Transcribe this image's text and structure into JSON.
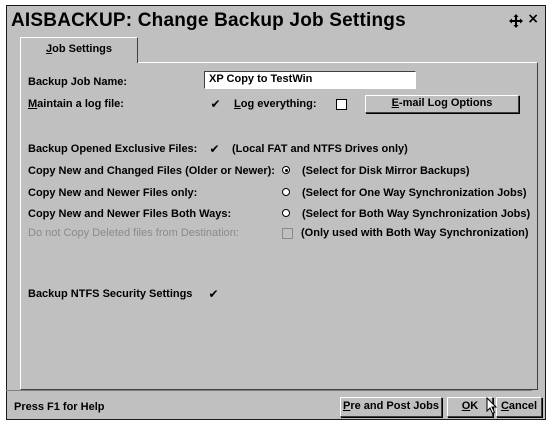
{
  "window": {
    "title": "AISBACKUP: Change Backup Job Settings"
  },
  "tabs": [
    {
      "label": "Job Settings",
      "underline": "J",
      "rest": "ob Settings"
    }
  ],
  "form": {
    "job_name_label": "Backup Job Name:",
    "job_name_value": "XP Copy to TestWin",
    "log_label_u": "M",
    "log_label_rest": "aintain a log file:",
    "log_checked": true,
    "log_everything_u": "L",
    "log_everything_rest": "og everything:",
    "log_everything_checked": false,
    "email_button_u": "E",
    "email_button_rest": "-mail Log Options",
    "opened_label": "Backup Opened Exclusive Files:",
    "opened_checked": true,
    "opened_note": "(Local FAT and NTFS Drives only)",
    "options": [
      {
        "label": "Copy New and Changed Files (Older or Newer):",
        "note": "(Select for Disk Mirror Backups)",
        "selected": true
      },
      {
        "label": "Copy New and Newer Files only:",
        "note": "(Select for One Way Synchronization Jobs)",
        "selected": false
      },
      {
        "label": "Copy New and Newer Files Both Ways:",
        "note": "(Select for Both Way Synchronization Jobs)",
        "selected": false
      }
    ],
    "deleted_label": "Do not Copy Deleted files from Destination:",
    "deleted_note": "(Only used with Both Way Synchronization)",
    "deleted_checked": false,
    "ntfs_label": "Backup NTFS Security Settings",
    "ntfs_checked": true
  },
  "status": {
    "help": "Press F1 for Help",
    "pre_post_u": "P",
    "pre_post_rest": "re and Post Jobs",
    "ok_u": "O",
    "ok_rest": "K",
    "cancel_u": "C",
    "cancel_rest": "ancel"
  },
  "icons": {
    "move": "move-arrows-icon",
    "close": "close-icon",
    "cursor": "mouse-pointer-icon"
  }
}
